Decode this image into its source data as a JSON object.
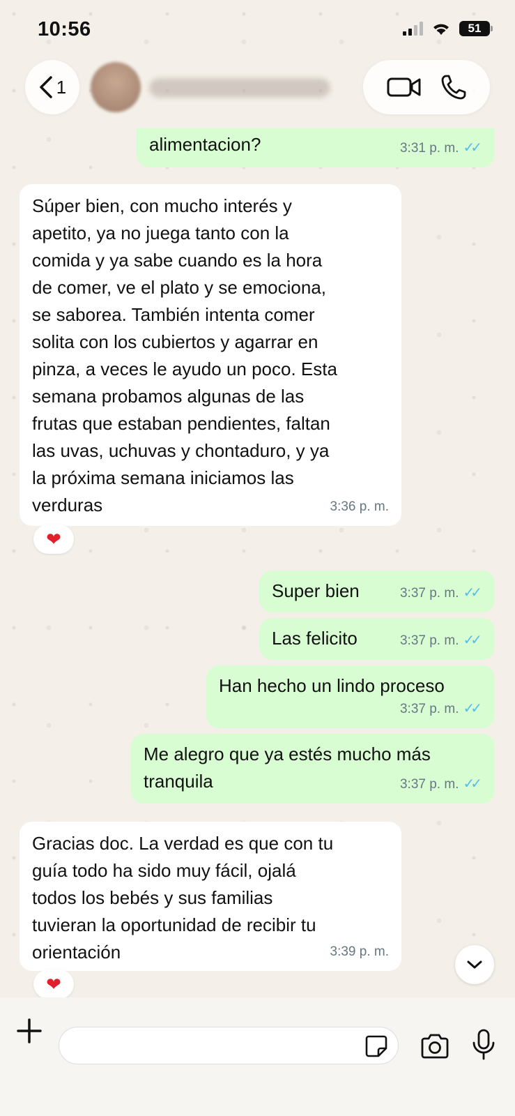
{
  "status_bar": {
    "time": "10:56",
    "battery": "51"
  },
  "header": {
    "back_count": "1"
  },
  "messages": [
    {
      "text": "alimentacion?",
      "time": "3:31 p. m."
    },
    {
      "text": "Súper bien, con mucho interés y\napetito, ya no juega tanto con la\ncomida y ya sabe cuando es la hora\nde comer, ve el plato y se emociona,\nse saborea. También intenta comer\nsolita con los cubiertos y agarrar en\npinza, a veces le ayudo un poco. Esta\nsemana probamos algunas de las\nfrutas que estaban pendientes, faltan\nlas uvas, uchuvas y chontaduro, y ya\nla próxima semana iniciamos las\nverduras",
      "time": "3:36 p. m.",
      "reaction": "❤"
    },
    {
      "text": "Super bien",
      "time": "3:37 p. m."
    },
    {
      "text": "Las felicito",
      "time": "3:37 p. m."
    },
    {
      "text": "Han hecho un lindo proceso",
      "time": "3:37 p. m."
    },
    {
      "text": "Me alegro que ya estés mucho más\ntranquila",
      "time": "3:37 p. m."
    },
    {
      "text": "Gracias doc. La verdad es que con tu\nguía todo ha sido muy fácil, ojalá\ntodos los bebés y sus familias\ntuvieran la oportunidad de recibir tu\norientación",
      "time": "3:39 p. m.",
      "reaction": "❤"
    }
  ],
  "composer": {
    "value": ""
  },
  "icons": {
    "back": "chevron-left-icon",
    "video": "video-camera-icon",
    "call": "phone-icon",
    "plus": "plus-icon",
    "sticker": "sticker-icon",
    "camera": "camera-icon",
    "mic": "microphone-icon",
    "scroll": "chevron-down-icon"
  },
  "colors": {
    "outgoing": "#d9fdd3",
    "incoming": "#ffffff",
    "read_ticks": "#53bdeb"
  }
}
